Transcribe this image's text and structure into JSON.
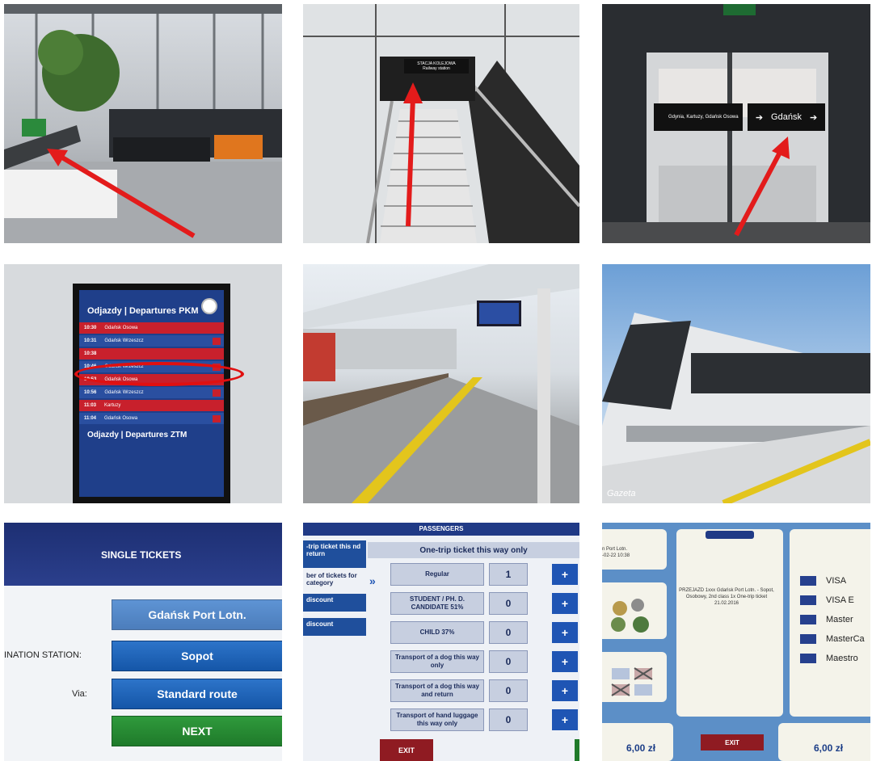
{
  "tiles": {
    "t2": {
      "sign_title": "STACJA KOLEJOWA",
      "sign_sub": "Railway station"
    },
    "t3": {
      "sign_left": "Gdynia, Kartuzy, Gdańsk Osowa",
      "sign_right": "Gdańsk"
    },
    "t4": {
      "pkm_title": "Odjazdy | Departures PKM",
      "ztm_title": "Odjazdy | Departures ZTM",
      "rows": [
        {
          "time": "10:30",
          "dest": "Gdańsk Osowa"
        },
        {
          "time": "10:31",
          "dest": "Gdańsk Wrzeszcz"
        },
        {
          "time": "10:38",
          "dest": ""
        },
        {
          "time": "10:46",
          "dest": "Gdańsk Wrzeszcz"
        },
        {
          "time": "10:53",
          "dest": "Gdańsk Osowa"
        },
        {
          "time": "10:56",
          "dest": "Gdańsk Wrzeszcz"
        },
        {
          "time": "11:03",
          "dest": "Kartuzy"
        },
        {
          "time": "11:04",
          "dest": "Gdańsk Osowa"
        }
      ]
    },
    "t6": {
      "watermark": "Gazeta"
    },
    "t7": {
      "title": "SINGLE TICKETS",
      "origin": "Gdańsk Port Lotn.",
      "destination_label": "INATION STATION:",
      "destination": "Sopot",
      "via_label": "Via:",
      "via": "Standard route",
      "next": "NEXT"
    },
    "t8": {
      "header": "PASSENGERS",
      "left_tabs": [
        "-trip ticket this nd return",
        "ber of tickets for category",
        "discount",
        "discount"
      ],
      "top": "One-trip ticket this way only",
      "rows": [
        {
          "label": "Regular",
          "qty": "1"
        },
        {
          "label": "STUDENT / PH. D. CANDIDATE 51%",
          "qty": "0"
        },
        {
          "label": "CHILD 37%",
          "qty": "0"
        },
        {
          "label": "Transport of a dog this way only",
          "qty": "0"
        },
        {
          "label": "Transport of a dog this way and return",
          "qty": "0"
        },
        {
          "label": "Transport of hand luggage this way only",
          "qty": "0"
        }
      ],
      "plus": "+",
      "exit": "EXIT"
    },
    "t9": {
      "ticket_text": "PRZEJAZD 1xxx Gdańsk Port Lotn. - Sopot, Osobowy, 2nd class 1x One-trip ticket 21.02.2016",
      "cards": [
        "VISA",
        "VISA E",
        "Master",
        "MasterCa",
        "Maestro"
      ],
      "price_left": "6,00 zł",
      "price_right": "6,00 zł",
      "exit": "EXIT",
      "airport_text": "n Port Lotn.",
      "date_text": "-02-22 10:38"
    }
  }
}
